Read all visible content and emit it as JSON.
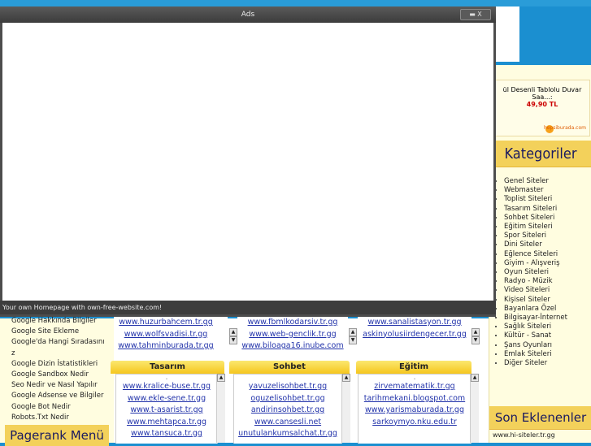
{
  "modal": {
    "title": "Ads",
    "controls": "▬ X",
    "footer": "Your own Homepage with own-free-website.com!"
  },
  "right_sidebar": {
    "ad": {
      "title": "ül Desenli Tablolu Duvar Saa...:",
      "price": "49,90 TL",
      "brand": "hepsiburada.com"
    },
    "categories_title": "Kategoriler",
    "categories": [
      "Genel Siteler",
      "Webmaster",
      "Toplist Siteleri",
      "Tasarım Siteleri",
      "Sohbet Siteleri",
      "Eğitim Siteleri",
      "Spor Siteleri",
      "Dini Siteler",
      "Eğlence Siteleri",
      "Giyim - Alışveriş",
      "Oyun Siteleri",
      "Radyo - Müzik",
      "Video Siteleri",
      "Kişisel Siteler",
      "Bayanlara Özel",
      "Bilgisayar-İnternet",
      "Sağlık Siteleri",
      "Kültür - Sanat",
      "Şans Oyunları",
      "Emlak Siteleri",
      "Diğer Siteler"
    ],
    "son_title": "Son Eklenenler",
    "son_first": "www.hi-siteler.tr.gg"
  },
  "left_sidebar": {
    "links": [
      "Google Hakkında Bilgiler",
      "Google Site Ekleme",
      "Google'da Hangi Sıradasını",
      "z",
      "Google Dizin İstatistikleri",
      "Google Sandbox Nedir",
      "Seo Nedir ve Nasıl Yapılır",
      "Google Adsense ve Bilgiler",
      "Google Bot Nedir",
      "Robots.Txt Nedir"
    ],
    "pagerank_title": "Pagerank Menü"
  },
  "top_boxes": [
    {
      "links": [
        "www.huzurbahcem.tr.gg",
        "www.wolfsvadisi.tr.gg",
        "www.tahminburada.tr.gg"
      ]
    },
    {
      "links": [
        "www.fbmlkodarsiv.tr.gg",
        "www.web-genclik.tr.gg",
        "www.biloaga16.inube.com"
      ]
    },
    {
      "links": [
        "www.sanalistasyon.tr.gg",
        "askinyolusiirdengecer.tr.gg"
      ]
    }
  ],
  "bottom_boxes": [
    {
      "title": "Tasarım",
      "links": [
        ".",
        "www.kralice-buse.tr.gg",
        "www.ekle-sene.tr.gg",
        "www.t-asarist.tr.gg",
        "www.mehtapca.tr.gg",
        "www.tansuca.tr.gg"
      ]
    },
    {
      "title": "Sohbet",
      "links": [
        "yavuzelisohbet.tr.gg",
        "oguzelisohbet.tr.gg",
        "andirinsohbet.tr.gg",
        "www.cansesli.net",
        "unutulankumsalchat.tr.gg"
      ]
    },
    {
      "title": "Eğitim",
      "links": [
        ".",
        "zirvematematik.tr.gg",
        "tarihmekani.blogspot.com",
        "www.yarismaburada.tr.gg",
        "sarkoymyo.nku.edu.tr"
      ]
    }
  ],
  "colors": {
    "page_bg": "#1b8fd0",
    "sidebar_bg": "#fffde0",
    "header_yellow": "#f3d15b",
    "link_blue": "#2233aa",
    "modal_border": "#4d4d4d"
  }
}
